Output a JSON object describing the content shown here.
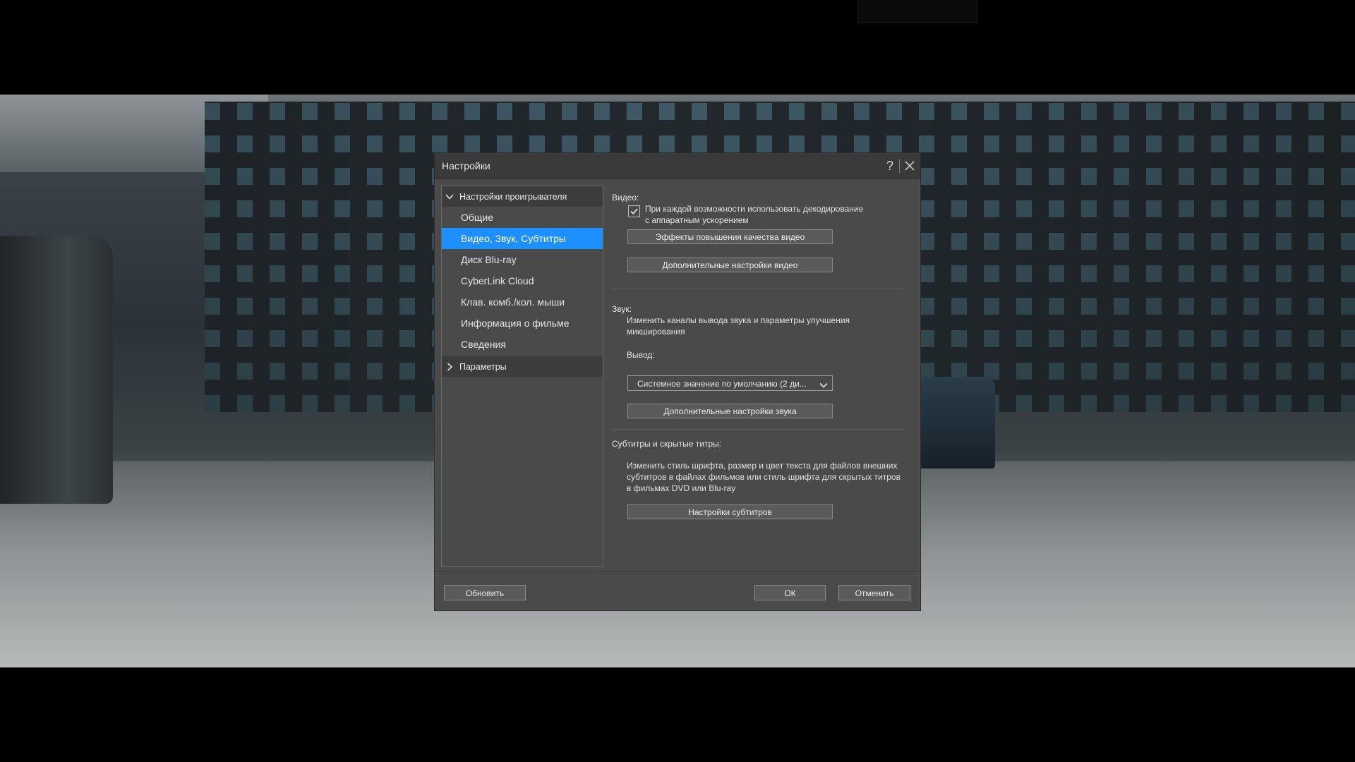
{
  "dialog": {
    "title": "Настройки",
    "help_glyph": "?",
    "close_icon": "close-icon"
  },
  "nav": {
    "group_player": "Настройки проигрывателя",
    "items": [
      {
        "label": "Общие",
        "selected": false
      },
      {
        "label": "Видео, Звук, Субтитры",
        "selected": true
      },
      {
        "label": "Диск Blu-ray",
        "selected": false
      },
      {
        "label": "CyberLink Cloud",
        "selected": false
      },
      {
        "label": "Клав. комб./кол. мыши",
        "selected": false
      },
      {
        "label": "Информация о фильме",
        "selected": false
      },
      {
        "label": "Сведения",
        "selected": false
      }
    ],
    "group_params": "Параметры"
  },
  "video": {
    "header": "Видео:",
    "hw_decode_checked": true,
    "hw_decode_line1": "При каждой возможности использовать декодирование",
    "hw_decode_line2": "с аппаратным ускорением",
    "enhance_button": "Эффекты повышения качества видео",
    "advanced_button": "Дополнительные настройки видео"
  },
  "audio": {
    "header": "Звук:",
    "desc_line1": "Изменить каналы вывода звука и параметры улучшения",
    "desc_line2": "микширования",
    "output_label": "Вывод:",
    "output_value": "Системное значение по умолчанию  (2 ди...",
    "advanced_button": "Дополнительные настройки звука"
  },
  "subtitles": {
    "header": "Субтитры и скрытые титры:",
    "desc_line1": "Изменить стиль шрифта, размер и цвет текста для файлов внешних",
    "desc_line2": "субтитров в файлах фильмов или стиль шрифта для скрытых титров",
    "desc_line3": "в фильмах DVD или Blu-ray",
    "settings_button": "Настройки субтитров"
  },
  "footer": {
    "update_button": "Обновить",
    "ok_button": "ОК",
    "cancel_button": "Отменить"
  },
  "colors": {
    "selection": "#1e8fff",
    "dialog_bg": "#4a4a4a",
    "titlebar_bg": "#3a3a3a"
  }
}
